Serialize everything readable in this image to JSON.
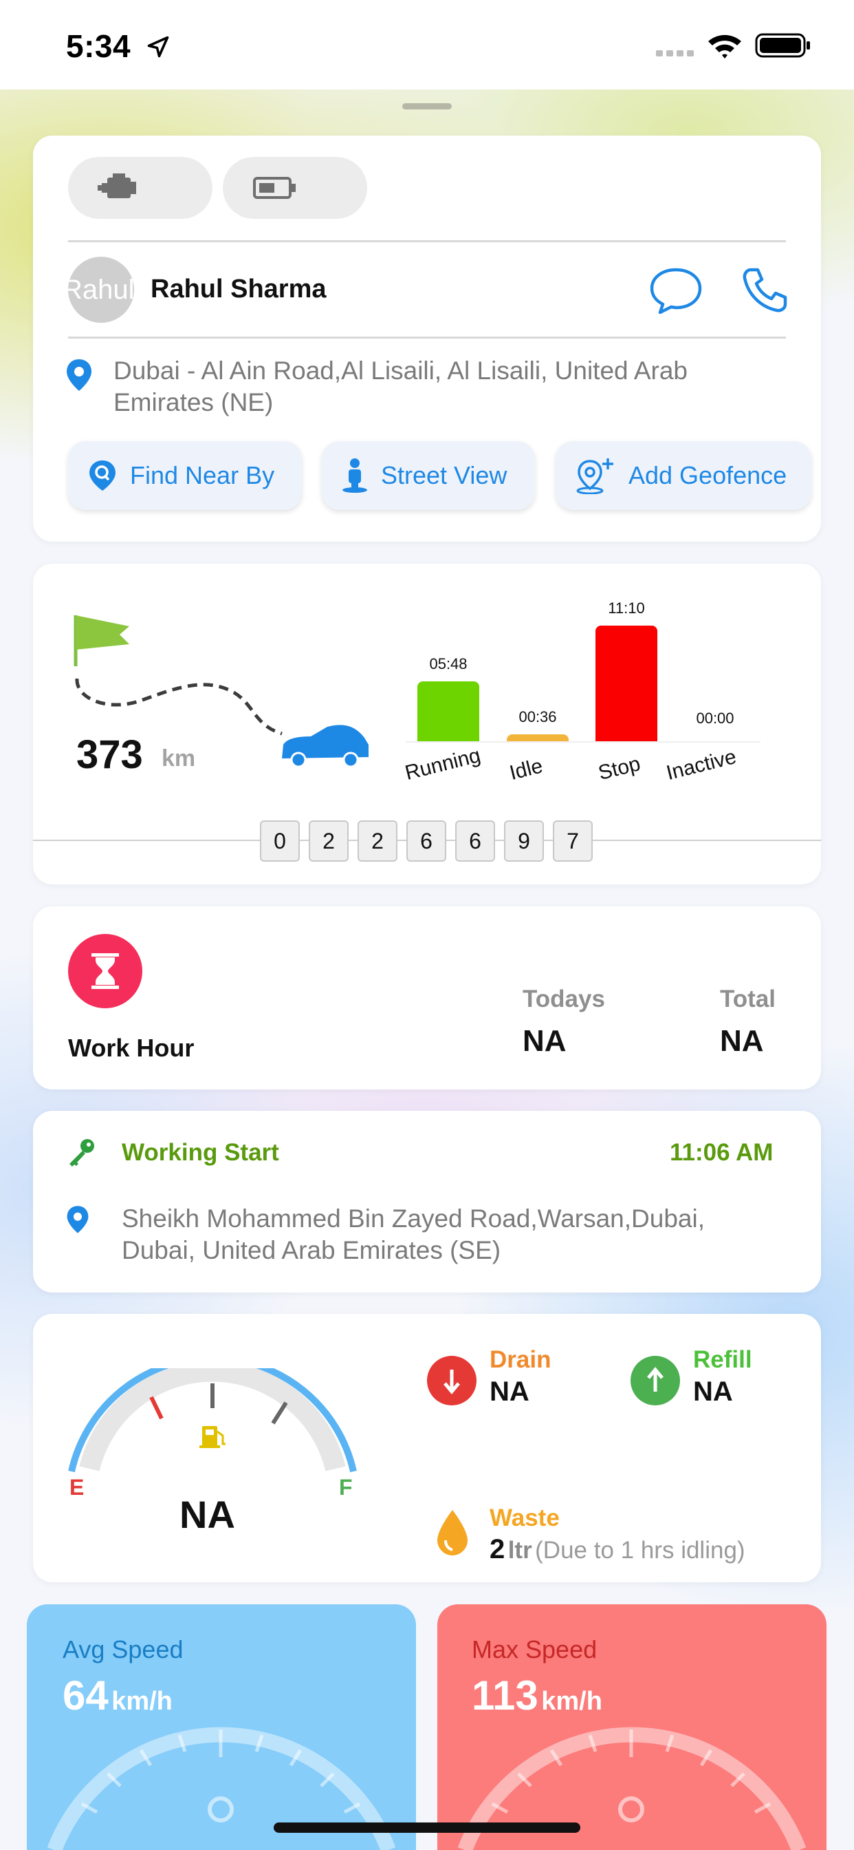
{
  "status_bar": {
    "time": "5:34"
  },
  "vehicle_card": {
    "driver_initials": "Rahul Sha",
    "driver_name": "Rahul Sharma",
    "address": "Dubai - Al Ain Road,Al Lisaili, Al Lisaili, United Arab Emirates (NE)",
    "actions": [
      {
        "label": "Find Near By",
        "icon": "map-pin-search-icon"
      },
      {
        "label": "Street View",
        "icon": "street-view-person-icon"
      },
      {
        "label": "Add Geofence",
        "icon": "add-geofence-icon"
      }
    ]
  },
  "distance": {
    "value": "373",
    "unit": "km"
  },
  "chart_data": {
    "type": "bar",
    "categories": [
      "Running",
      "Idle",
      "Stop",
      "Inactive"
    ],
    "labels": [
      "05:48",
      "00:36",
      "11:10",
      "00:00"
    ],
    "values": [
      348,
      36,
      670,
      0
    ],
    "colors": [
      "#6ed400",
      "#f3b43a",
      "#fb0000",
      "#cfcfcf"
    ]
  },
  "odometer": [
    "0",
    "2",
    "2",
    "6",
    "6",
    "9",
    "7"
  ],
  "work_hour": {
    "title": "Work Hour",
    "todays_label": "Todays",
    "todays_value": "NA",
    "total_label": "Total",
    "total_value": "NA"
  },
  "working_start": {
    "label": "Working Start",
    "time": "11:06 AM",
    "address": "Sheikh Mohammed Bin Zayed Road,Warsan,Dubai, Dubai, United Arab Emirates (SE)"
  },
  "fuel": {
    "empty_label": "E",
    "full_label": "F",
    "value": "NA",
    "drain_label": "Drain",
    "drain_value": "NA",
    "refill_label": "Refill",
    "refill_value": "NA",
    "waste_label": "Waste",
    "waste_amount": "2",
    "waste_unit": "ltr",
    "waste_note": "(Due to 1 hrs idling)"
  },
  "avg_speed": {
    "label": "Avg Speed",
    "value": "64",
    "unit": "km/h"
  },
  "max_speed": {
    "label": "Max Speed",
    "value": "113",
    "unit": "km/h"
  },
  "colors": {
    "accent_blue": "#1e88e5",
    "green": "#5a9a0e",
    "red": "#e53935"
  }
}
